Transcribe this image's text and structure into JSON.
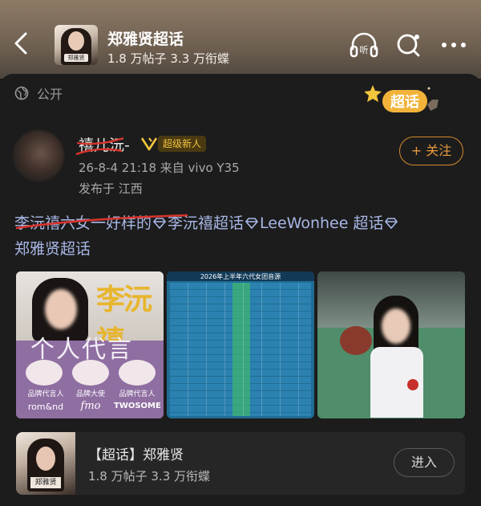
{
  "header": {
    "title": "郑雅贤超话",
    "subtitle": "1.8 万帖子  3.3 万衔蝶",
    "avatar_label": "郑雅贤"
  },
  "post": {
    "visibility": "公开",
    "badge_label": "超话",
    "author": "禧儿沅-",
    "level_badge": "超级新人",
    "follow_label": "+ 关注",
    "meta_time": "26-8-4 21:18  来自 vivo Y35",
    "meta_location": "发布于 江西",
    "tag_struck": "李沅禧六女一好样的",
    "tag2": "李沅禧超话",
    "tag3": "LeeWonhee 超话",
    "tag4": "郑雅贤超话"
  },
  "images": {
    "img1": {
      "name_big": "李沅禧",
      "slogan": "个人代言",
      "labels": [
        "品牌代言人",
        "品牌大使",
        "品牌代言人"
      ],
      "brands": [
        "rom&nd",
        "fmo",
        "TWOSOME"
      ]
    },
    "img2": {
      "title": "2026年上半年六代女团音源"
    },
    "img3": {}
  },
  "linkcard": {
    "title": "【超话】郑雅贤",
    "subtitle": "1.8 万帖子  3.3 万衔蝶",
    "button_label": "进入",
    "thumb_label": "郑雅贤"
  },
  "colors": {
    "accent_orange": "#e69a3e",
    "topic_blue": "#a8b7e6",
    "strike_red": "#d8342c"
  }
}
